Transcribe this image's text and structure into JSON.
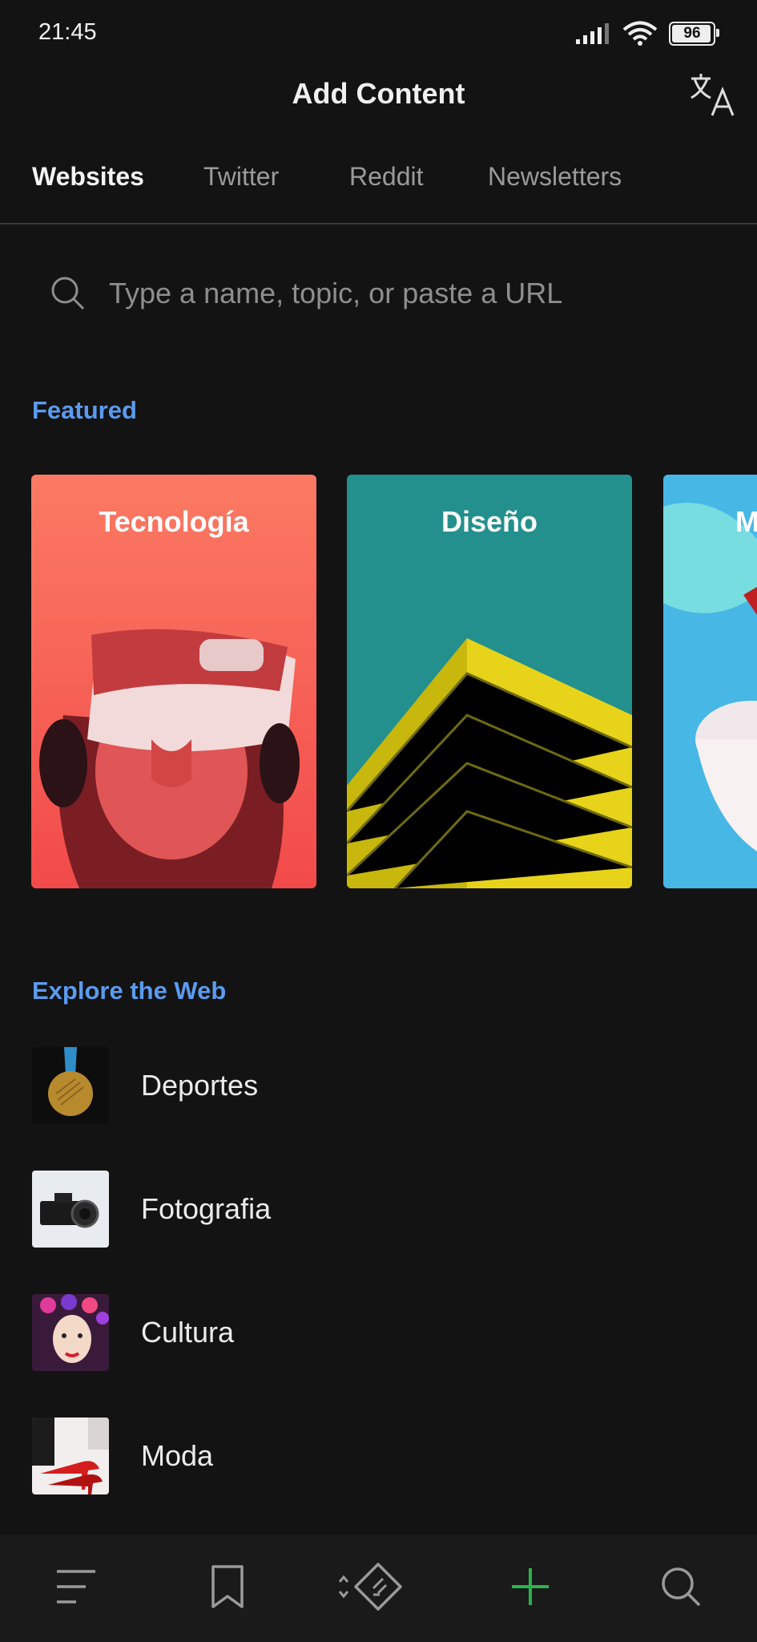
{
  "status_bar": {
    "time": "21:45",
    "battery": "96"
  },
  "header": {
    "title": "Add Content"
  },
  "tabs": [
    {
      "label": "Websites",
      "active": true
    },
    {
      "label": "Twitter",
      "active": false
    },
    {
      "label": "Reddit",
      "active": false
    },
    {
      "label": "Newsletters",
      "active": false
    }
  ],
  "search": {
    "placeholder": "Type a name, topic, or paste a URL"
  },
  "featured": {
    "label": "Featured",
    "cards": [
      {
        "title": "Tecnología"
      },
      {
        "title": "Diseño"
      },
      {
        "title": "M"
      }
    ]
  },
  "explore": {
    "label": "Explore the Web",
    "items": [
      {
        "label": "Deportes"
      },
      {
        "label": "Fotografia"
      },
      {
        "label": "Cultura"
      },
      {
        "label": "Moda"
      }
    ]
  },
  "bottom_nav": {
    "items": [
      "menu-icon",
      "bookmark-icon",
      "feedly-icon",
      "add-icon",
      "search-icon"
    ],
    "active": "add-icon"
  },
  "colors": {
    "accent_blue": "#5b9bf0",
    "accent_green": "#2bb24c",
    "background": "#131313"
  }
}
